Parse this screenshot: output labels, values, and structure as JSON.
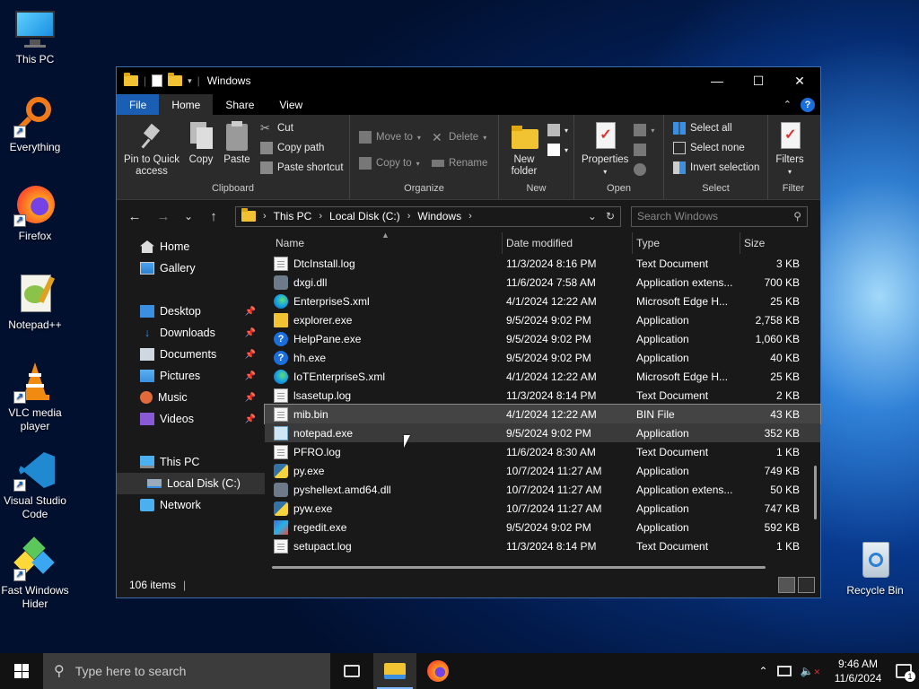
{
  "desktop": {
    "icons": [
      {
        "label": "This PC",
        "icon": "monitor-icon"
      },
      {
        "label": "Everything",
        "icon": "magnifier-icon"
      },
      {
        "label": "Firefox",
        "icon": "firefox-icon"
      },
      {
        "label": "Notepad++",
        "icon": "notepadpp-icon"
      },
      {
        "label": "VLC media player",
        "icon": "vlc-cone-icon"
      },
      {
        "label": "Visual Studio Code",
        "icon": "vscode-icon"
      },
      {
        "label": "Fast Windows Hider",
        "icon": "cubes-icon"
      }
    ],
    "recycle_bin": "Recycle Bin"
  },
  "window": {
    "title": "Windows",
    "controls": {
      "minimize": "—",
      "maximize": "☐",
      "close": "✕"
    }
  },
  "tabs": [
    "File",
    "Home",
    "Share",
    "View"
  ],
  "ribbon": {
    "clipboard": {
      "pin": "Pin to Quick access",
      "copy": "Copy",
      "paste": "Paste",
      "cut": "Cut",
      "copy_path": "Copy path",
      "paste_shortcut": "Paste shortcut",
      "label": "Clipboard"
    },
    "organize": {
      "move_to": "Move to",
      "copy_to": "Copy to",
      "delete": "Delete",
      "rename": "Rename",
      "label": "Organize"
    },
    "new": {
      "new_folder": "New folder",
      "label": "New"
    },
    "open": {
      "properties": "Properties",
      "label": "Open"
    },
    "select": {
      "select_all": "Select all",
      "select_none": "Select none",
      "invert": "Invert selection",
      "label": "Select"
    },
    "filter": {
      "filters": "Filters",
      "label": "Filter"
    }
  },
  "address": {
    "crumbs": [
      "This PC",
      "Local Disk (C:)",
      "Windows"
    ],
    "search_placeholder": "Search Windows"
  },
  "nav": {
    "home": "Home",
    "gallery": "Gallery",
    "desktop": "Desktop",
    "downloads": "Downloads",
    "documents": "Documents",
    "pictures": "Pictures",
    "music": "Music",
    "videos": "Videos",
    "this_pc": "This PC",
    "local_disk": "Local Disk (C:)",
    "network": "Network"
  },
  "columns": {
    "name": "Name",
    "date": "Date modified",
    "type": "Type",
    "size": "Size"
  },
  "files": [
    {
      "name": "DtcInstall.log",
      "date": "11/3/2024 8:16 PM",
      "type": "Text Document",
      "size": "3 KB",
      "icon": "text-file-icon"
    },
    {
      "name": "dxgi.dll",
      "date": "11/6/2024 7:58 AM",
      "type": "Application extens...",
      "size": "700 KB",
      "icon": "dll-file-icon"
    },
    {
      "name": "EnterpriseS.xml",
      "date": "4/1/2024 12:22 AM",
      "type": "Microsoft Edge H...",
      "size": "25 KB",
      "icon": "edge-icon"
    },
    {
      "name": "explorer.exe",
      "date": "9/5/2024 9:02 PM",
      "type": "Application",
      "size": "2,758 KB",
      "icon": "folder-app-icon"
    },
    {
      "name": "HelpPane.exe",
      "date": "9/5/2024 9:02 PM",
      "type": "Application",
      "size": "1,060 KB",
      "icon": "help-icon"
    },
    {
      "name": "hh.exe",
      "date": "9/5/2024 9:02 PM",
      "type": "Application",
      "size": "40 KB",
      "icon": "help-icon"
    },
    {
      "name": "IoTEnterpriseS.xml",
      "date": "4/1/2024 12:22 AM",
      "type": "Microsoft Edge H...",
      "size": "25 KB",
      "icon": "edge-icon"
    },
    {
      "name": "lsasetup.log",
      "date": "11/3/2024 8:14 PM",
      "type": "Text Document",
      "size": "2 KB",
      "icon": "text-file-icon"
    },
    {
      "name": "mib.bin",
      "date": "4/1/2024 12:22 AM",
      "type": "BIN File",
      "size": "43 KB",
      "icon": "blank-file-icon"
    },
    {
      "name": "notepad.exe",
      "date": "9/5/2024 9:02 PM",
      "type": "Application",
      "size": "352 KB",
      "icon": "notepad-icon"
    },
    {
      "name": "PFRO.log",
      "date": "11/6/2024 8:30 AM",
      "type": "Text Document",
      "size": "1 KB",
      "icon": "text-file-icon"
    },
    {
      "name": "py.exe",
      "date": "10/7/2024 11:27 AM",
      "type": "Application",
      "size": "749 KB",
      "icon": "python-icon"
    },
    {
      "name": "pyshellext.amd64.dll",
      "date": "10/7/2024 11:27 AM",
      "type": "Application extens...",
      "size": "50 KB",
      "icon": "dll-file-icon"
    },
    {
      "name": "pyw.exe",
      "date": "10/7/2024 11:27 AM",
      "type": "Application",
      "size": "747 KB",
      "icon": "python-icon"
    },
    {
      "name": "regedit.exe",
      "date": "9/5/2024 9:02 PM",
      "type": "Application",
      "size": "592 KB",
      "icon": "registry-icon"
    },
    {
      "name": "setupact.log",
      "date": "11/3/2024 8:14 PM",
      "type": "Text Document",
      "size": "1 KB",
      "icon": "text-file-icon"
    }
  ],
  "selected_file": "mib.bin",
  "hovered_file": "notepad.exe",
  "status": {
    "item_count": "106 items"
  },
  "taskbar": {
    "search_placeholder": "Type here to search",
    "time": "9:46 AM",
    "date": "11/6/2024"
  },
  "colors": {
    "accent": "#1a5fb4",
    "window_bg": "#191919",
    "ribbon_bg": "#2b2b2b"
  }
}
